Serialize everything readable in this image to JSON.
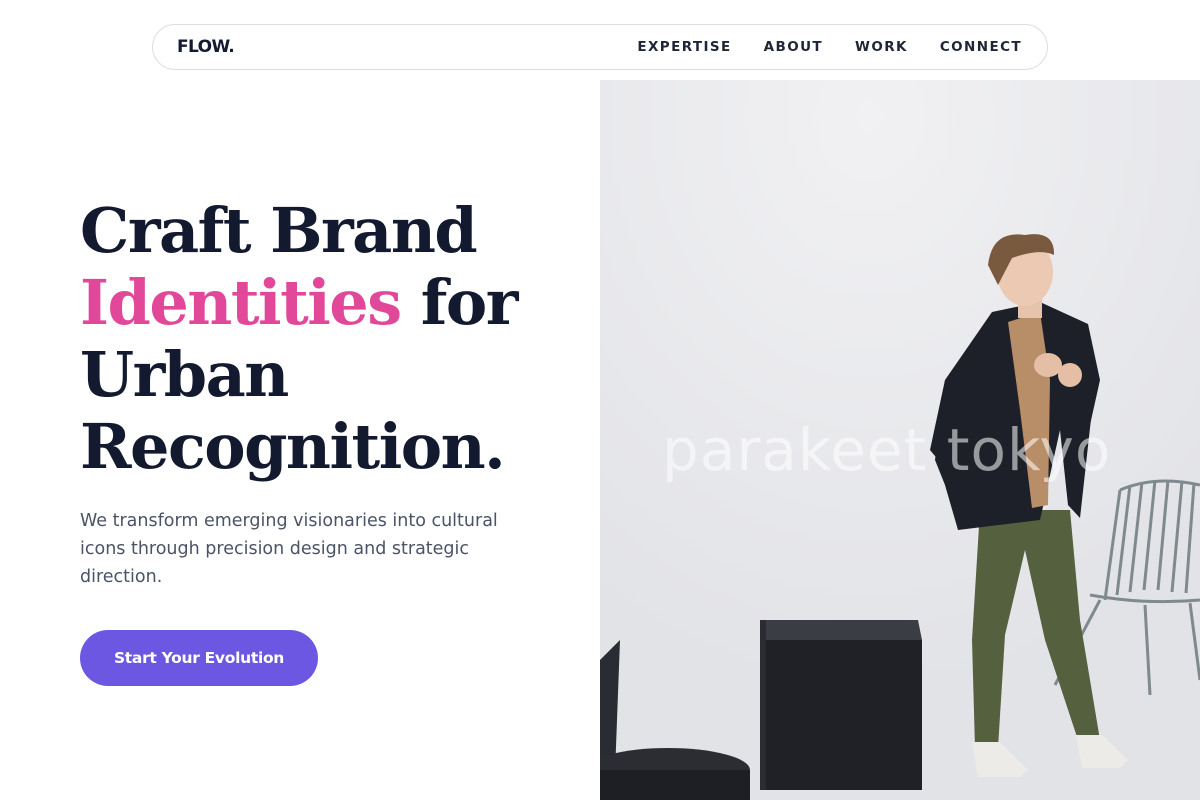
{
  "nav": {
    "logo": "FLOW.",
    "links": [
      "EXPERTISE",
      "ABOUT",
      "WORK",
      "CONNECT"
    ]
  },
  "hero": {
    "headline": {
      "line1": "Craft Brand",
      "line2_accent": "Identities",
      "line2_rest": " for",
      "line3": "Urban",
      "line4": "Recognition."
    },
    "subtitle": "We transform emerging visionaries into cultural icons through precision design and strategic direction.",
    "cta_label": "Start Your Evolution",
    "image_watermark": "parakeet tokyo"
  },
  "colors": {
    "accent_pink": "#e2489a",
    "cta_purple": "#6b57e2",
    "heading_navy": "#131a30"
  }
}
